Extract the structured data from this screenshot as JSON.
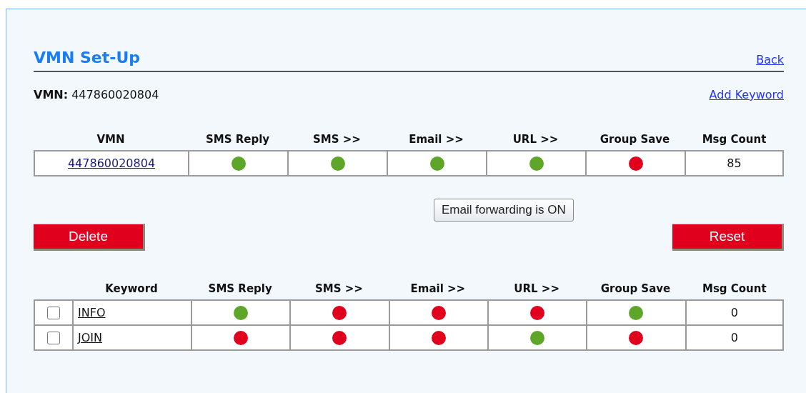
{
  "title": "VMN Set-Up",
  "back_link": "Back",
  "vmn_line": {
    "label": "VMN:",
    "value": "447860020804"
  },
  "add_keyword_link": "Add Keyword",
  "vmn_table": {
    "columns": [
      "VMN",
      "SMS Reply",
      "SMS >>",
      "Email >>",
      "URL >>",
      "Group Save",
      "Msg Count"
    ],
    "rows": [
      {
        "vmn": "447860020804",
        "flags": [
          {
            "on": true
          },
          {
            "on": true
          },
          {
            "on": true
          },
          {
            "on": true
          },
          {
            "on": false
          }
        ],
        "msg_count": "85"
      }
    ]
  },
  "tooltip": "Email forwarding is ON",
  "buttons": {
    "delete": "Delete",
    "reset": "Reset"
  },
  "keyword_table": {
    "columns": [
      "Keyword",
      "SMS Reply",
      "SMS >>",
      "Email >>",
      "URL >>",
      "Group Save",
      "Msg Count"
    ],
    "rows": [
      {
        "checked": false,
        "keyword": "INFO",
        "flags": [
          {
            "on": true
          },
          {
            "on": false
          },
          {
            "on": false
          },
          {
            "on": false
          },
          {
            "on": true
          }
        ],
        "msg_count": "0"
      },
      {
        "checked": false,
        "keyword": "JOIN",
        "flags": [
          {
            "on": false
          },
          {
            "on": false
          },
          {
            "on": false
          },
          {
            "on": true
          },
          {
            "on": false
          }
        ],
        "msg_count": "0"
      }
    ]
  }
}
